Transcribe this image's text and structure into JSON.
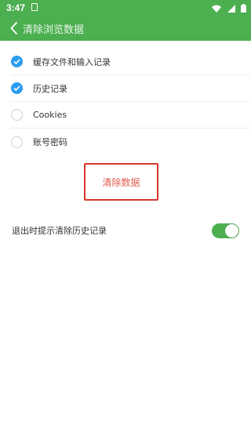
{
  "status_bar": {
    "time": "3:47",
    "icons": [
      "notification-icon",
      "wifi-icon",
      "signal-icon",
      "battery-icon"
    ]
  },
  "app_bar": {
    "title": "清除浏览数据",
    "back_icon": "back-arrow-icon",
    "color": "#4caf50"
  },
  "options": [
    {
      "label": "缓存文件和输入记录",
      "checked": true
    },
    {
      "label": "历史记录",
      "checked": true
    },
    {
      "label": "Cookies",
      "checked": false
    },
    {
      "label": "账号密码",
      "checked": false
    }
  ],
  "clear_button": {
    "label": "清除数据",
    "color": "#e05a4f"
  },
  "exit_prompt": {
    "label": "退出时提示清除历史记录",
    "enabled": true
  },
  "colors": {
    "accent": "#4caf50",
    "check": "#2b9df0",
    "highlight": "#d9342b"
  }
}
